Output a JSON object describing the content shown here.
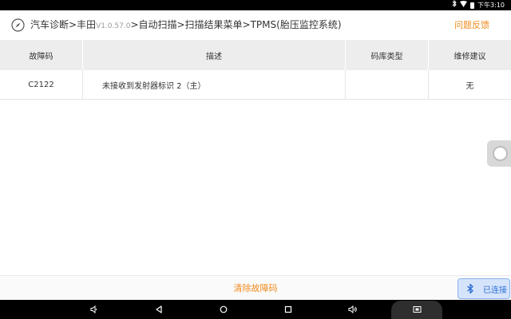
{
  "status_bar": {
    "time": "下午3:10",
    "icons": [
      "bluetooth-icon",
      "wifi-icon",
      "battery-icon"
    ]
  },
  "header": {
    "icon": "compass-icon",
    "path_part1": "汽车诊断>丰田",
    "version": "V1.0.57.0",
    "path_part2": ">自动扫描>扫描结果菜单>TPMS(胎压监控系统)",
    "feedback_label": "问题反馈"
  },
  "table": {
    "columns": [
      "故障码",
      "描述",
      "码库类型",
      "维修建议"
    ],
    "rows": [
      {
        "code": "C2122",
        "description": "未接收到发射器标识 2（主）",
        "type": "",
        "advice": "无"
      }
    ]
  },
  "actions": {
    "clear_codes_label": "清除故障码",
    "connection_label": "已连接",
    "connection_icon": "bluetooth-icon"
  },
  "nav_bar": {
    "buttons": [
      "volume-down-icon",
      "back-icon",
      "home-icon",
      "recents-icon",
      "volume-up-icon",
      "screenshot-icon"
    ]
  },
  "colors": {
    "accent": "#f08a1c",
    "header_bg": "#ededed",
    "connected_bg": "#d6e4fb",
    "connected_text": "#2f6fd6"
  }
}
